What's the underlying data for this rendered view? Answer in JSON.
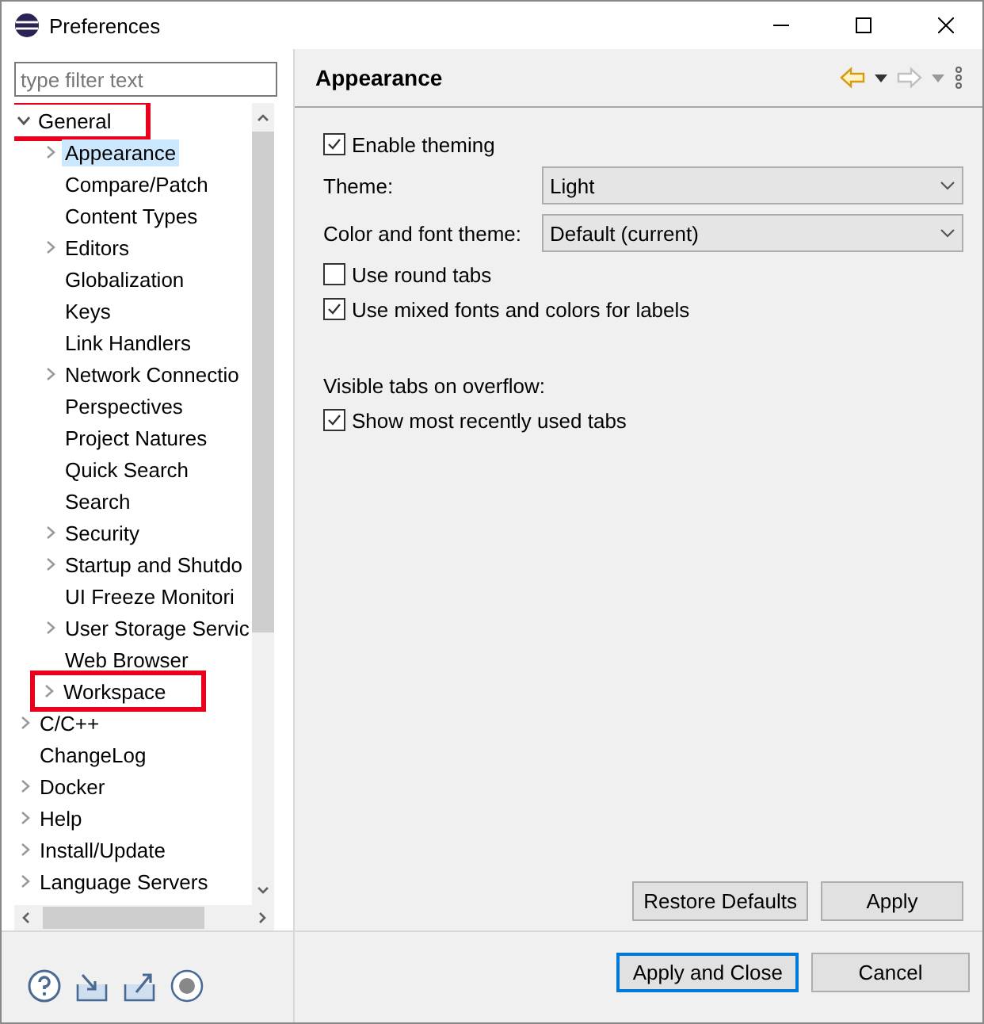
{
  "window": {
    "title": "Preferences"
  },
  "filter": {
    "placeholder": "type filter text"
  },
  "tree": [
    {
      "label": "General",
      "expanded": true,
      "highlighted": true,
      "selected": false,
      "children": [
        {
          "label": "Appearance",
          "expandable": true,
          "selected": true,
          "highlighted": false
        },
        {
          "label": "Compare/Patch",
          "expandable": false,
          "selected": false,
          "highlighted": false
        },
        {
          "label": "Content Types",
          "expandable": false,
          "selected": false,
          "highlighted": false
        },
        {
          "label": "Editors",
          "expandable": true,
          "selected": false,
          "highlighted": false
        },
        {
          "label": "Globalization",
          "expandable": false,
          "selected": false,
          "highlighted": false
        },
        {
          "label": "Keys",
          "expandable": false,
          "selected": false,
          "highlighted": false
        },
        {
          "label": "Link Handlers",
          "expandable": false,
          "selected": false,
          "highlighted": false
        },
        {
          "label": "Network Connectio",
          "expandable": true,
          "selected": false,
          "highlighted": false
        },
        {
          "label": "Perspectives",
          "expandable": false,
          "selected": false,
          "highlighted": false
        },
        {
          "label": "Project Natures",
          "expandable": false,
          "selected": false,
          "highlighted": false
        },
        {
          "label": "Quick Search",
          "expandable": false,
          "selected": false,
          "highlighted": false
        },
        {
          "label": "Search",
          "expandable": false,
          "selected": false,
          "highlighted": false
        },
        {
          "label": "Security",
          "expandable": true,
          "selected": false,
          "highlighted": false
        },
        {
          "label": "Startup and Shutdo",
          "expandable": true,
          "selected": false,
          "highlighted": false
        },
        {
          "label": "UI Freeze Monitori",
          "expandable": false,
          "selected": false,
          "highlighted": false
        },
        {
          "label": "User Storage Servic",
          "expandable": true,
          "selected": false,
          "highlighted": false
        },
        {
          "label": "Web Browser",
          "expandable": false,
          "selected": false,
          "highlighted": false
        },
        {
          "label": "Workspace",
          "expandable": true,
          "selected": false,
          "highlighted": true
        }
      ]
    },
    {
      "label": "C/C++",
      "expanded": false,
      "expandable": true,
      "selected": false,
      "highlighted": false
    },
    {
      "label": "ChangeLog",
      "expanded": false,
      "expandable": false,
      "selected": false,
      "highlighted": false
    },
    {
      "label": "Docker",
      "expanded": false,
      "expandable": true,
      "selected": false,
      "highlighted": false
    },
    {
      "label": "Help",
      "expanded": false,
      "expandable": true,
      "selected": false,
      "highlighted": false
    },
    {
      "label": "Install/Update",
      "expanded": false,
      "expandable": true,
      "selected": false,
      "highlighted": false
    },
    {
      "label": "Language Servers",
      "expanded": false,
      "expandable": true,
      "selected": false,
      "highlighted": false
    }
  ],
  "page": {
    "title": "Appearance",
    "settings": [
      {
        "kind": "checkbox",
        "label": "Enable theming",
        "checked": true
      },
      {
        "kind": "select",
        "label": "Theme:",
        "value": "Light"
      },
      {
        "kind": "select",
        "label": "Color and font theme:",
        "value": "Default (current)"
      },
      {
        "kind": "checkbox",
        "label": "Use round tabs",
        "checked": false
      },
      {
        "kind": "checkbox",
        "label": "Use mixed fonts and colors for labels",
        "checked": true
      },
      {
        "kind": "heading",
        "label": "Visible tabs on overflow:"
      },
      {
        "kind": "checkbox",
        "label": "Show most recently used tabs",
        "checked": true
      }
    ],
    "buttons": [
      "Restore Defaults",
      "Apply"
    ]
  },
  "footer_buttons": [
    {
      "label": "Apply and Close",
      "default": true
    },
    {
      "label": "Cancel",
      "default": false
    }
  ]
}
